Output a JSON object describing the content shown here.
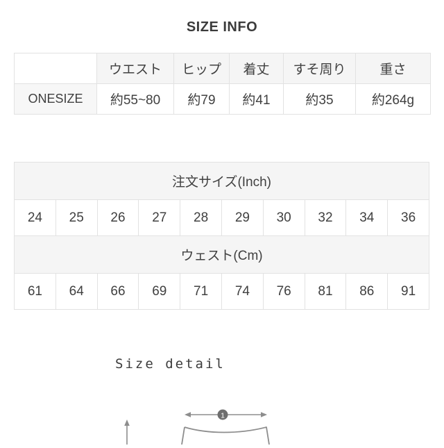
{
  "header": {
    "title": "SIZE INFO"
  },
  "size_info_table": {
    "name": "size-info-table",
    "columns": [
      "",
      "ウエスト",
      "ヒップ",
      "着丈",
      "すそ周り",
      "重さ"
    ],
    "rows": [
      {
        "label": "ONESIZE",
        "values": [
          "約55~80",
          "約79",
          "約41",
          "約35",
          "約264g"
        ]
      }
    ]
  },
  "conversion_table": {
    "name": "order-size-conversion-table",
    "groups": [
      {
        "heading": "注文サイズ(Inch)",
        "values": [
          "24",
          "25",
          "26",
          "27",
          "28",
          "29",
          "30",
          "32",
          "34",
          "36"
        ]
      },
      {
        "heading": "ウェスト(Cm)",
        "values": [
          "61",
          "64",
          "66",
          "69",
          "71",
          "74",
          "76",
          "81",
          "86",
          "91"
        ]
      }
    ]
  },
  "size_detail": {
    "title": "Size detail",
    "measurement_badge": "1",
    "icons": {
      "horizontal_arrow": "double-headed-horizontal-arrow-icon",
      "vertical_arrow": "up-arrow-icon",
      "garment": "skirt-outline-icon"
    }
  },
  "colors": {
    "border": "#e2e2e2",
    "header_bg": "#f5f5f5",
    "row_label_bg": "#f7f7f7",
    "text": "#404040",
    "title_text": "#3b3b3b",
    "diagram_line": "#8d8d8d",
    "badge_fill": "#6e6e6e"
  }
}
